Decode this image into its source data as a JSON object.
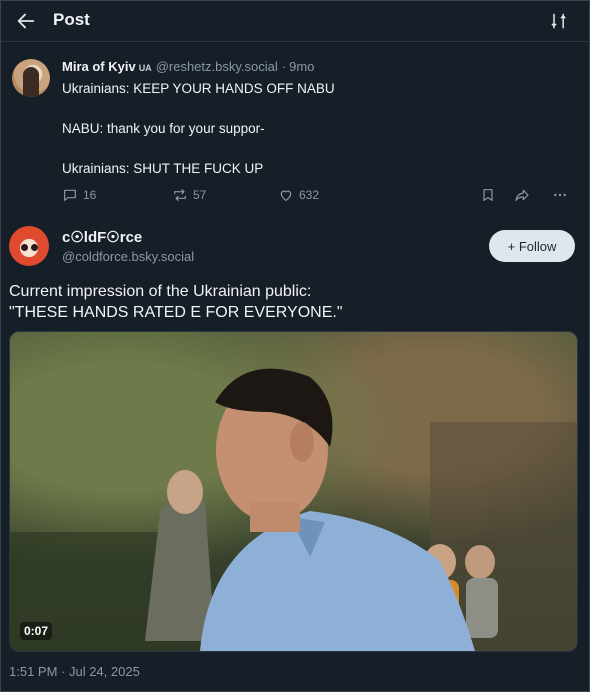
{
  "header": {
    "title": "Post"
  },
  "parent_post": {
    "author_name": "Mira of Kyiv",
    "flag": "UA",
    "handle": "@reshetz.bsky.social",
    "age": "9mo",
    "lines": [
      "Ukrainians: KEEP YOUR HANDS OFF NABU",
      "NABU: thank you for your suppor-",
      "Ukrainians: SHUT THE FUCK UP"
    ],
    "replies": "16",
    "reposts": "57",
    "likes": "632"
  },
  "main_post": {
    "author_name": "c☉ldF☉rce",
    "handle": "@coldforce.bsky.social",
    "follow_label": "+ Follow",
    "text_line1": "Current impression of the Ukrainian public:",
    "text_line2": "\"THESE HANDS RATED E FOR EVERYONE.\"",
    "video_duration": "0:07",
    "timestamp": "1:51 PM · Jul 24, 2025"
  },
  "icons": {
    "back": "arrow-left-icon",
    "filter": "sort-filter-icon",
    "reply": "reply-icon",
    "repost": "repost-icon",
    "like": "heart-icon",
    "bookmark": "bookmark-icon",
    "share": "share-icon",
    "more": "more-icon"
  },
  "colors": {
    "background": "#161e27",
    "muted_text": "#8a98a8",
    "follow_button_bg": "#dfe6ee"
  }
}
